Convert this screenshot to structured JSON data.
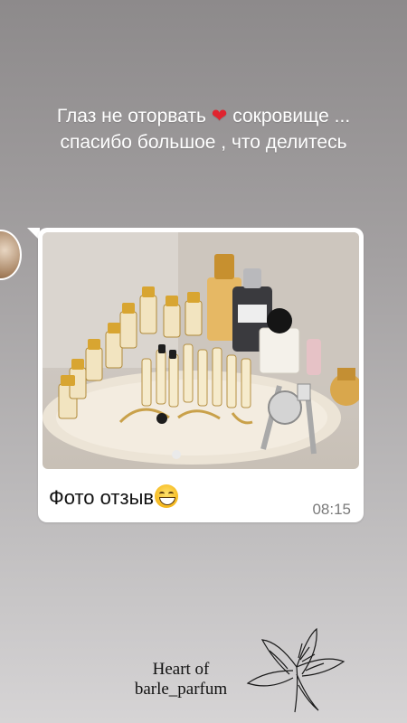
{
  "story": {
    "caption_line1_part1": "Глаз не оторвать",
    "caption_heart_icon": "red-heart",
    "caption_line1_part2": "сокровище ...",
    "caption_line2": "спасибо большое , что делитесь"
  },
  "message": {
    "photo_icon": "perfume-collection-photo",
    "text": "Фото отзыв",
    "emoji_icon": "grinning-face",
    "time": "08:15"
  },
  "brand": {
    "line1": "Heart of",
    "line2": "barle_parfum",
    "logo_icon": "lily-flower-line-art"
  },
  "colors": {
    "bubble": "#ffffff",
    "background_top": "#8d8a8b",
    "background_bottom": "#d6d4d5",
    "heart": "#e0242f"
  }
}
